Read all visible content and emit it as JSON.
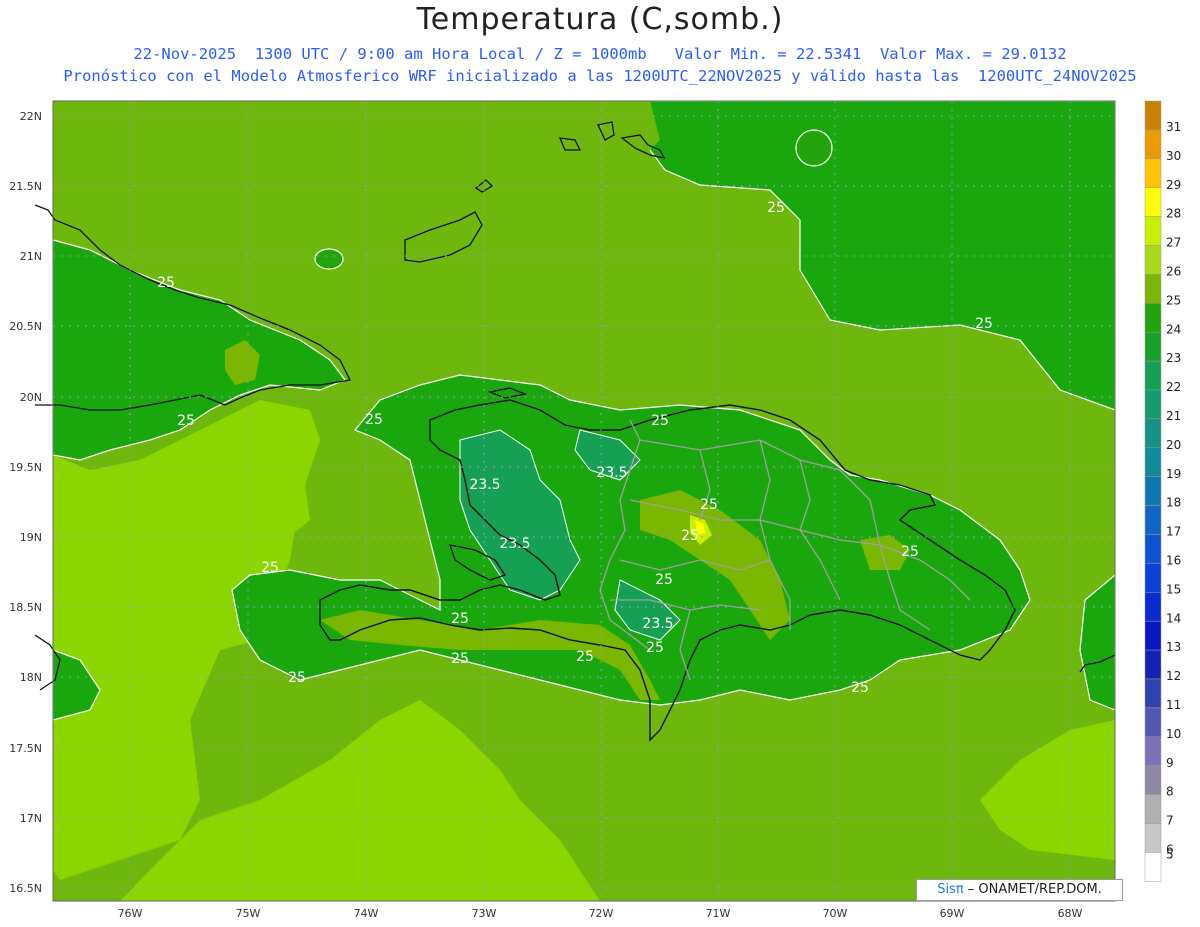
{
  "title": "Temperatura (C,somb.)",
  "subtitle1": "22-Nov-2025  1300 UTC / 9:00 am Hora Local / Z = 1000mb   Valor Min. = 22.5341  Valor Max. = 29.0132",
  "subtitle2": "Pronóstico con el Modelo Atmosferico WRF inicializado a las 1200UTC_22NOV2025 y válido hasta las  1200UTC_24NOV2025",
  "lat_labels": [
    "22N",
    "21.5N",
    "21N",
    "20.5N",
    "20N",
    "19.5N",
    "19N",
    "18.5N",
    "18N",
    "17.5N",
    "17N",
    "16.5N"
  ],
  "lon_labels": [
    "76W",
    "75W",
    "74W",
    "73W",
    "72W",
    "71W",
    "70W",
    "69W",
    "68W"
  ],
  "colorbar": {
    "levels": [
      "31",
      "30",
      "29",
      "28",
      "27",
      "26",
      "25",
      "24",
      "23",
      "22",
      "21",
      "20",
      "19",
      "18",
      "17",
      "16",
      "15",
      "14",
      "13",
      "12",
      "11",
      "10",
      "9",
      "8",
      "7",
      "6",
      "5"
    ],
    "colors": [
      "#c98200",
      "#e99b00",
      "#ffc400",
      "#ffff00",
      "#c8f000",
      "#a9d91b",
      "#79b700",
      "#24a40c",
      "#1aa02a",
      "#16a053",
      "#159a6e",
      "#139285",
      "#118a9a",
      "#1078b1",
      "#0f66c4",
      "#0e54d2",
      "#0c40d6",
      "#0a2bd0",
      "#0a16c2",
      "#1620b4",
      "#3042ae",
      "#5058b0",
      "#7b72b8",
      "#9087a4",
      "#b0b0b0",
      "#c8c8c8",
      "#ffffff"
    ]
  },
  "contour_labels": [
    "25",
    "25",
    "25",
    "25",
    "25",
    "25",
    "25",
    "25",
    "25",
    "25",
    "25",
    "25",
    "25",
    "25",
    "23.5",
    "23.5",
    "23.5",
    "23.5"
  ],
  "credit": {
    "sis": "Sisπ",
    "org": " – ONAMET/REP.DOM."
  },
  "colors": {
    "land_dark": "#1aa70e",
    "sea_light": "#8cd600",
    "sea_mid": "#6eb70c",
    "coast": "#111111",
    "border": "#a0a0a0"
  }
}
